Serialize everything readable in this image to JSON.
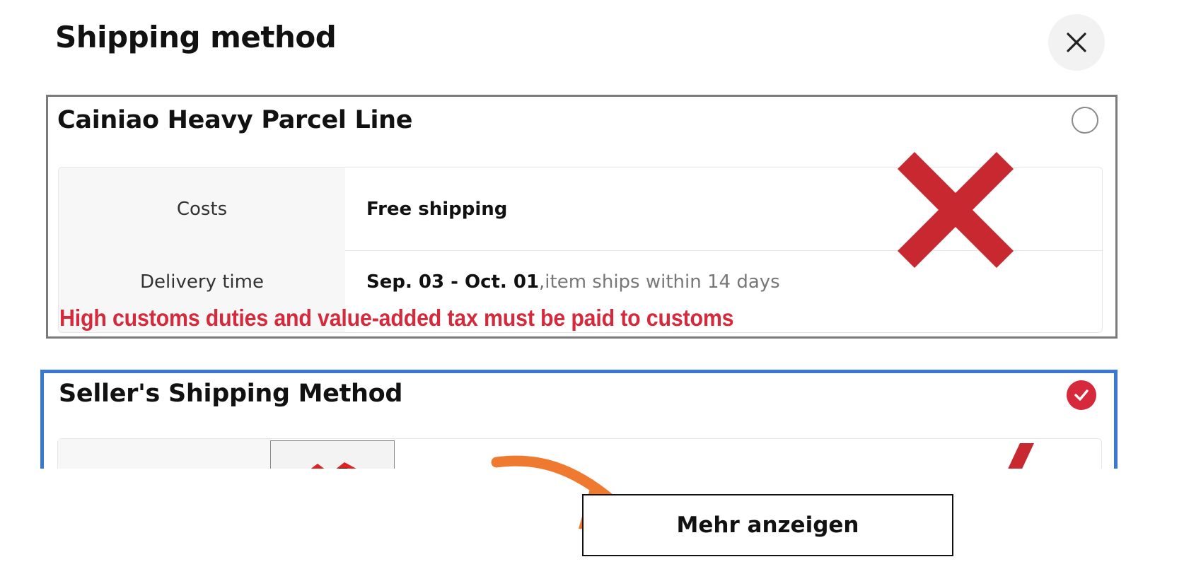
{
  "modal": {
    "title": "Shipping method"
  },
  "options": [
    {
      "name": "Cainiao Heavy Parcel Line",
      "selected": false,
      "rows": [
        {
          "label": "Costs",
          "value": "Free shipping",
          "note": ""
        },
        {
          "label": "Delivery time",
          "value": "Sep. 03 - Oct. 01",
          "note": " ,item ships within 14 days"
        }
      ],
      "warning": "High customs duties and value-added tax must be paid to customs"
    },
    {
      "name": "Seller's Shipping Method",
      "selected": true
    }
  ],
  "buttons": {
    "more_label": "Mehr anzeigen"
  },
  "icons": {
    "close": "close-icon",
    "checked": "checkmark-icon",
    "annotation_x": "red-x-icon",
    "annotation_arrow": "orange-arrow-icon"
  },
  "colors": {
    "selected_border": "#3a78d6",
    "unselected_border": "#7a7a7a",
    "accent_red": "#d6293b",
    "arrow_orange": "#ef7a2f"
  }
}
